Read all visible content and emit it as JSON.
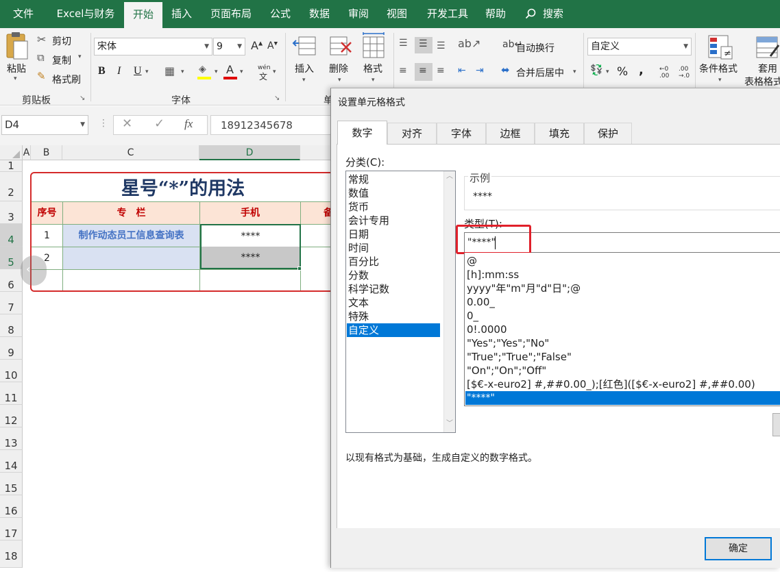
{
  "ribbon_tabs": [
    "文件",
    "Excel与财务",
    "开始",
    "插入",
    "页面布局",
    "公式",
    "数据",
    "审阅",
    "视图",
    "开发工具",
    "帮助",
    "搜索"
  ],
  "clipboard": {
    "paste": "粘贴",
    "cut": "剪切",
    "copy": "复制",
    "format_painter": "格式刷",
    "group": "剪贴板"
  },
  "font": {
    "name": "宋体",
    "size": "9",
    "group": "字体",
    "phonetic": "wén"
  },
  "cells_group": {
    "insert": "插入",
    "delete": "删除",
    "format": "格式",
    "group_partial": "单"
  },
  "alignment": {
    "wrap": "自动换行",
    "merge": "合并后居中"
  },
  "number": {
    "format": "自定义",
    "percent": "%",
    "comma": ","
  },
  "styles": {
    "conditional": "条件格式",
    "table_line1": "套用",
    "table_line2": "表格格式"
  },
  "formula_bar": {
    "name_box": "D4",
    "value": "18912345678",
    "fx": "fx"
  },
  "columns": [
    "A",
    "B",
    "C",
    "D"
  ],
  "rows": [
    "1",
    "2",
    "3",
    "4",
    "5",
    "6",
    "7",
    "8",
    "9",
    "10",
    "11",
    "12",
    "13",
    "14",
    "15",
    "16",
    "17",
    "18"
  ],
  "sheet": {
    "title": "星号“*”的用法",
    "headers": {
      "seq": "序号",
      "col": "专　栏",
      "phone": "手机",
      "note_partial": "备"
    },
    "r1": {
      "seq": "1",
      "col": "制作动态员工信息查询表",
      "phone": "****"
    },
    "r2": {
      "seq": "2",
      "col": "",
      "phone": "****"
    }
  },
  "dialog": {
    "title": "设置单元格格式",
    "tabs": [
      "数字",
      "对齐",
      "字体",
      "边框",
      "填充",
      "保护"
    ],
    "category_label": "分类(C):",
    "categories": [
      "常规",
      "数值",
      "货币",
      "会计专用",
      "日期",
      "时间",
      "百分比",
      "分数",
      "科学记数",
      "文本",
      "特殊",
      "自定义"
    ],
    "selected_category": "自定义",
    "sample_label": "示例",
    "sample_value": "****",
    "type_label": "类型(T):",
    "type_value": "\"****\"",
    "formats": [
      "@",
      "[h]:mm:ss",
      "yyyy\"年\"m\"月\"d\"日\";@",
      "0.00_",
      "0_",
      "0!.0000",
      "\"Yes\";\"Yes\";\"No\"",
      "\"True\";\"True\";\"False\"",
      "\"On\";\"On\";\"Off\"",
      "[$€-x-euro2] #,##0.00_);[红色]([$€-x-euro2] #,##0.00)",
      "\"****\""
    ],
    "selected_format": "\"****\"",
    "description": "以现有格式为基础，生成自定义的数字格式。",
    "ok": "确定"
  },
  "colors": {
    "excel_green": "#217346",
    "title_blue": "#1f3864",
    "header_red": "#c00000",
    "header_fill": "#fce4d6",
    "select_blue": "#0078d7",
    "highlight_red": "#e0202a"
  }
}
